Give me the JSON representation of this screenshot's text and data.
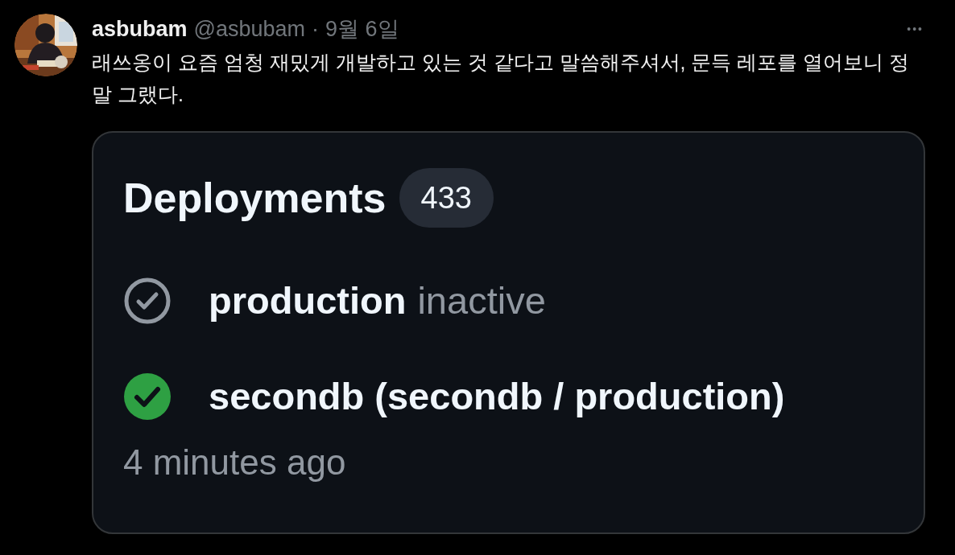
{
  "post": {
    "author": "asbubam",
    "handle": "@asbubam",
    "separator": "·",
    "date": "9월 6일",
    "more": "•••",
    "text": "래쓰옹이 요즘 엄청 재밌게 개발하고 있는 것 같다고 말씀해주셔서, 문득 레포를 열어보니 정말 그랬다."
  },
  "card": {
    "title": "Deployments",
    "count": "433",
    "deployments": [
      {
        "name": "production",
        "status_text": "inactive",
        "success": false
      },
      {
        "name": "secondb (secondb / production)",
        "success": true
      }
    ],
    "time": "4 minutes ago"
  }
}
